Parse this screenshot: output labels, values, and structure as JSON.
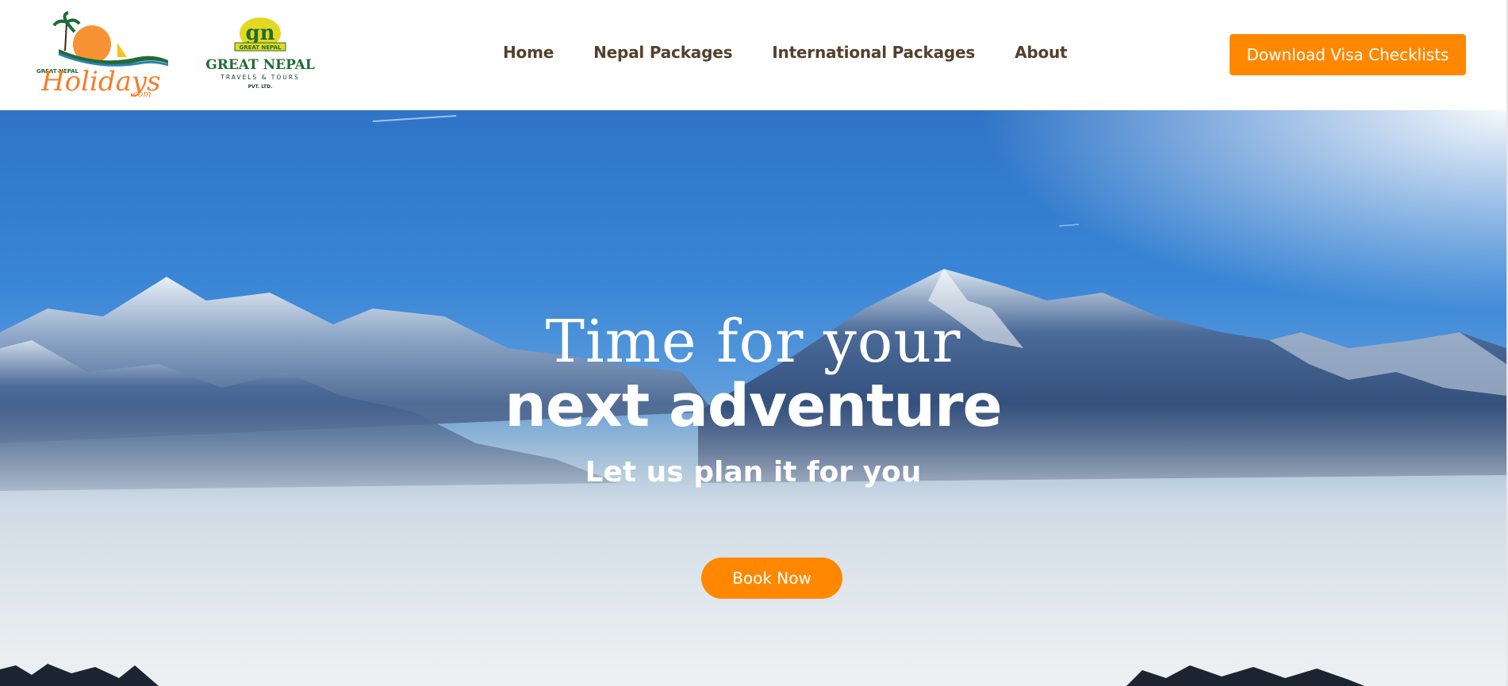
{
  "header": {
    "logo_holidays": {
      "icon": "great-nepal-holidays-logo",
      "small_text": "GREAT NEPAL",
      "script_text": "Holidays",
      "suffix": ".com"
    },
    "logo_gn": {
      "icon": "great-nepal-travels-logo",
      "monogram": "gn",
      "badge": "GREAT NEPAL",
      "title": "GREAT NEPAL",
      "subtitle": "TRAVELS & TOURS",
      "suffix": "PVT. LTD."
    },
    "nav": [
      {
        "label": "Home"
      },
      {
        "label": "Nepal Packages"
      },
      {
        "label": "International Packages"
      },
      {
        "label": "About"
      }
    ],
    "cta_label": "Download Visa Checklists"
  },
  "hero": {
    "line1": "Time for your",
    "line2": "next adventure",
    "line3": "Let us plan it for you",
    "button_label": "Book Now"
  },
  "colors": {
    "accent": "#ff8800",
    "nav_text": "#54402b",
    "brand_green": "#1f6b35"
  }
}
